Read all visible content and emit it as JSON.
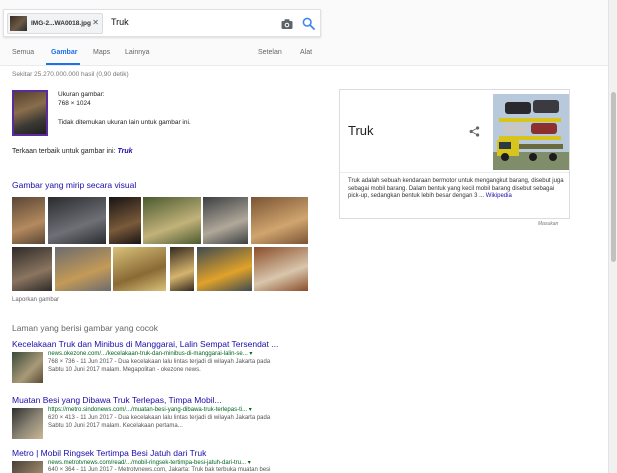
{
  "search": {
    "chip_text": "IMG-2...WA0018.jpg",
    "query": "Truk",
    "icons": [
      "camera-icon",
      "search-icon",
      "close-icon"
    ]
  },
  "tabs": [
    {
      "label": "Semua"
    },
    {
      "label": "Gambar"
    },
    {
      "label": "Maps"
    },
    {
      "label": "Lainnya"
    },
    {
      "label": "Setelan"
    },
    {
      "label": "Alat"
    }
  ],
  "result_stats": "Sekitar 25.270.000.000 hasil (0,90 detik)",
  "query_image": {
    "size_label": "Ukuran gambar:",
    "size_value": "768 × 1024",
    "no_size": "Tidak ditemukan ukuran lain untuk gambar ini.",
    "best_guess_prefix": "Terkaan terbaik untuk gambar ini:",
    "best_guess_link": "Truk"
  },
  "similar": {
    "title": "Gambar yang mirip secara visual",
    "report": "Laporkan gambar",
    "colors": [
      [
        "#5a4634",
        "#b48a5f"
      ],
      [
        "#2a2b2e",
        "#6f7077"
      ],
      [
        "#181414",
        "#7a5a3a"
      ],
      [
        "#4a5a2f",
        "#c2b27a"
      ],
      [
        "#3c3f42",
        "#b0a89a"
      ],
      [
        "#7a5434",
        "#d0a56f"
      ],
      [
        "#2e2a28",
        "#8a7560"
      ],
      [
        "#6b6b6e",
        "#c49a57"
      ],
      [
        "#d9c27a",
        "#8a6a35"
      ],
      [
        "#33291f",
        "#d6b46e"
      ],
      [
        "#3e4a52",
        "#e0a22a"
      ],
      [
        "#8a4d2a",
        "#d9c6ac"
      ]
    ]
  },
  "pages_title": "Laman yang berisi gambar yang cocok",
  "results": [
    {
      "title": "Kecelakaan Truk dan Minibus di Manggarai, Lalin Sempat Tersendat ...",
      "url": "news.okezone.com/.../kecelakaan-truk-dan-minibus-di-manggarai-lalin-se... ▾",
      "line1": "768 × 736 - 11 Jun 2017 - Dua kecelakaan lalu lintas terjadi di wilayah Jakarta pada",
      "line2": "Sabtu 10 Juni 2017 malam. Megapolitan - okezone news."
    },
    {
      "title": "Muatan Besi yang Dibawa Truk Terlepas, Timpa Mobil...",
      "url": "https://metro.sindonews.com/.../muatan-besi-yang-dibawa-truk-terlepas-ti... ▾",
      "line1": "620 × 413 - 11 Jun 2017 - Dua kecelakaan lalu lintas terjadi di wilayah Jakarta pada",
      "line2": "Sabtu 10 Juni 2017 malam. Kecelakaan pertama..."
    },
    {
      "title": "Metro | Mobil Ringsek Tertimpa Besi Jatuh dari Truk",
      "url": "news.metrotvnews.com/read/.../mobil-ringsek-tertimpa-besi-jatuh-dari-tru... ▾",
      "line1": "640 × 364 - 11 Jun 2017 - Metrotvnews.com, Jakarta: Truk bak terbuka muatan besi",
      "line2": ""
    }
  ],
  "knowledge": {
    "title": "Truk",
    "desc": "Truk adalah sebuah kendaraan bermotor untuk mengangkut barang, disebut juga sebagai mobil barang. Dalam bentuk yang kecil mobil barang disebut sebagai pick-up, sedangkan bentuk lebih besar dengan 3 ...",
    "link": "Wikipedia",
    "feedback": "Masukan"
  }
}
